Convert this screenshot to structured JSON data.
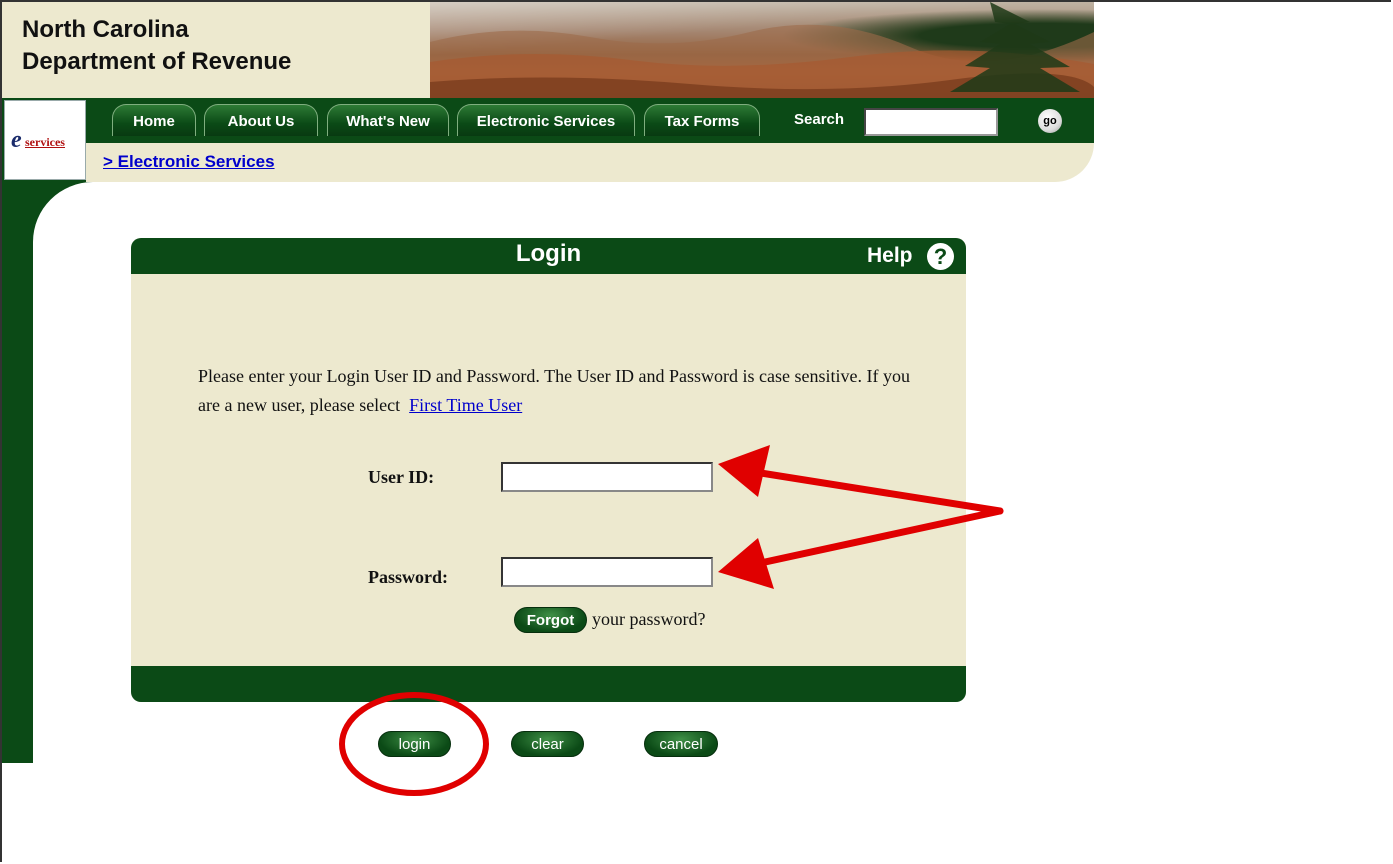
{
  "header": {
    "org_line1": "North Carolina",
    "org_line2": "Department of Revenue"
  },
  "nav": {
    "tabs": [
      {
        "label": "Home"
      },
      {
        "label": "About Us"
      },
      {
        "label": "What's New"
      },
      {
        "label": "Electronic Services"
      },
      {
        "label": "Tax Forms"
      }
    ],
    "search_label": "Search",
    "search_value": "",
    "go_label": "go"
  },
  "logo": {
    "e": "e",
    "services": "services"
  },
  "breadcrumb": "> Electronic Services",
  "login": {
    "title": "Login",
    "help_label": "Help",
    "help_icon": "?",
    "instructions": "Please enter your Login User ID and Password. The User ID and Password is case sensitive. If you are a new user, please select",
    "first_time_link": "First Time User",
    "user_id_label": "User ID:",
    "user_id_value": "",
    "password_label": "Password:",
    "password_value": "",
    "forgot_button": "Forgot",
    "forgot_suffix": "your password?"
  },
  "actions": {
    "login": "login",
    "clear": "clear",
    "cancel": "cancel"
  },
  "colors": {
    "dark_green": "#0b4a16",
    "cream": "#ede9cf",
    "link_blue": "#0000cc",
    "annotation_red": "#e00000"
  }
}
